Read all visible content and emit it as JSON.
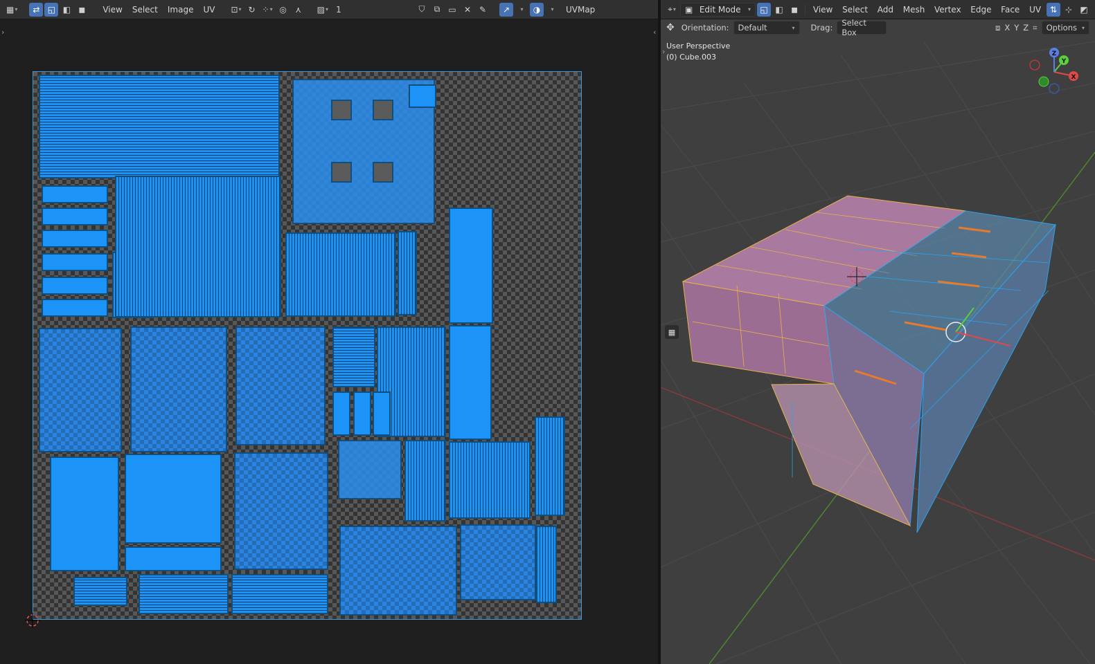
{
  "uv_editor": {
    "header": {
      "menus": [
        "View",
        "Select",
        "Image",
        "UV"
      ],
      "frame_number": "1",
      "uvmap_label": "UVMap"
    },
    "colors": {
      "island_fill": "#1c93f7",
      "island_edge": "#0f4f80",
      "boundary": "#3d9ce0"
    }
  },
  "viewport": {
    "header": {
      "mode_label": "Edit Mode",
      "menus": [
        "View",
        "Select",
        "Add",
        "Mesh",
        "Vertex",
        "Edge",
        "Face",
        "UV"
      ]
    },
    "subheader": {
      "orientation_label": "Orientation:",
      "orientation_value": "Default",
      "drag_label": "Drag:",
      "drag_value": "Select Box",
      "axis_x": "X",
      "axis_y": "Y",
      "axis_z": "Z",
      "options_label": "Options"
    },
    "overlay": {
      "view_name": "User Perspective",
      "object_name": "(0) Cube.003"
    },
    "gizmo": {
      "x": "X",
      "y": "Y",
      "z": "Z"
    },
    "colors": {
      "face": "#b77fb0",
      "edge": "#e7b24a",
      "selected": "#29a3f0",
      "grid": "#4a4a4a"
    }
  }
}
